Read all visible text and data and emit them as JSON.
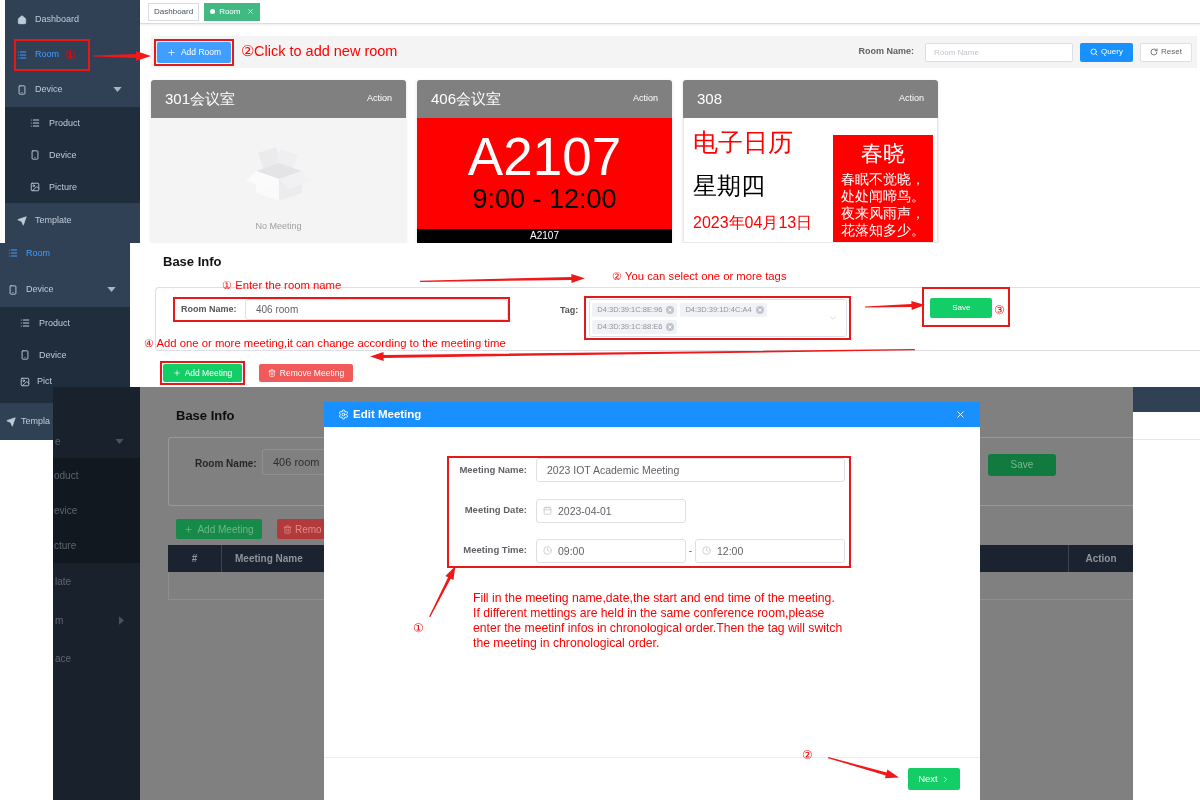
{
  "overview": {
    "sidebar": [
      {
        "label": "Dashboard",
        "selected": false
      },
      {
        "label": "Room",
        "selected": true,
        "note": "①"
      },
      {
        "label": "Device",
        "selected": false,
        "expanded": true,
        "children": [
          {
            "label": "Product",
            "selected": false
          },
          {
            "label": "Device",
            "selected": false
          },
          {
            "label": "Picture",
            "selected": false
          }
        ]
      },
      {
        "label": "Template",
        "selected": false
      }
    ],
    "tabs": [
      {
        "label": "Dashboard",
        "selected": false,
        "closable": false
      },
      {
        "label": "Room",
        "selected": true,
        "closable": true
      }
    ],
    "toolbar": {
      "add_button": "Add Room",
      "add_note": "②Click to add new room",
      "search_label": "Room Name:",
      "search": {
        "placeholder": "Room Name"
      },
      "query_button": "Query",
      "reset_button": "Reset"
    },
    "rooms": [
      {
        "kind": "empty",
        "title": "301会议室",
        "action": "Action",
        "message": "No Meeting"
      },
      {
        "kind": "meeting",
        "title": "406会议室",
        "action": "Action",
        "code": "A2107",
        "time": "9:00 - 12:00",
        "footer": "A2107"
      },
      {
        "kind": "calendar",
        "title": "308",
        "action": "Action",
        "heading": "电子日历",
        "weekday": "星期四",
        "date": "2023年04月13日",
        "poem_title": "春晓",
        "poem_lines": [
          "春眠不觉晓，",
          "处处闻啼鸟。",
          "夜来风雨声，",
          "花落知多少。"
        ]
      }
    ]
  },
  "room_form": {
    "sidebar": [
      {
        "label": "Room",
        "selected": true
      },
      {
        "label": "Device",
        "selected": false,
        "expanded": true,
        "children": [
          {
            "label": "Product",
            "selected": false
          },
          {
            "label": "Device",
            "selected": false
          },
          {
            "label": "Pict",
            "selected": false
          }
        ]
      },
      {
        "label": "Templa",
        "selected": false
      }
    ],
    "title": "Base Info",
    "room_name": {
      "label": "Room Name:",
      "value": "406 room",
      "note": "① Enter the room name"
    },
    "tag": {
      "label": "Tag:",
      "tags": [
        "D4:3D:39:1C:8E:96",
        "D4:3D:39:1D:4C:A4",
        "D4:3D:39:1C:88:E6"
      ],
      "note": "② You can select one or more tags"
    },
    "save_button": "Save",
    "save_note": "③",
    "meeting_note": "④ Add one or more meeting,it can change according to the meeting time",
    "add_button": "Add Meeting",
    "remove_button": "Remove Meeting"
  },
  "meeting_editor": {
    "sidebar": [
      {
        "label": "e",
        "selected": false,
        "expanded": true,
        "children": [
          {
            "label": "oduct",
            "selected": false
          },
          {
            "label": "evice",
            "selected": false
          },
          {
            "label": "cture",
            "selected": false
          }
        ]
      },
      {
        "label": "late",
        "selected": false
      },
      {
        "label": "m",
        "selected": false,
        "expanded": false
      },
      {
        "label": "ace",
        "selected": false
      }
    ],
    "page": {
      "title": "Base Info",
      "room_name": {
        "label": "Room Name:",
        "value": "406 room"
      },
      "save_button": "Save",
      "add_button": "Add Meeting",
      "remove_button": "Remo",
      "table": {
        "columns": [
          "#",
          "Meeting Name",
          "Action"
        ]
      }
    },
    "dialog": {
      "title": "Edit Meeting",
      "fields": [
        {
          "kind": "text",
          "label": "Meeting Name:",
          "value": "2023 IOT Academic Meeting"
        },
        {
          "kind": "date",
          "label": "Meeting Date:",
          "value": "2023-04-01"
        },
        {
          "kind": "time_range",
          "label": "Meeting Time:",
          "start": "09:00",
          "separator": "-",
          "end": "12:00"
        }
      ],
      "marker": "①",
      "note": "Fill in the meeting name,date,the start and end time of the meeting.\nIf different mettings are held in the same conference room,please\nenter the meetinf infos in chronological order.Then the tag will switch\nthe meeting in chronological order.",
      "next_button": "Next",
      "next_marker": "②"
    }
  }
}
